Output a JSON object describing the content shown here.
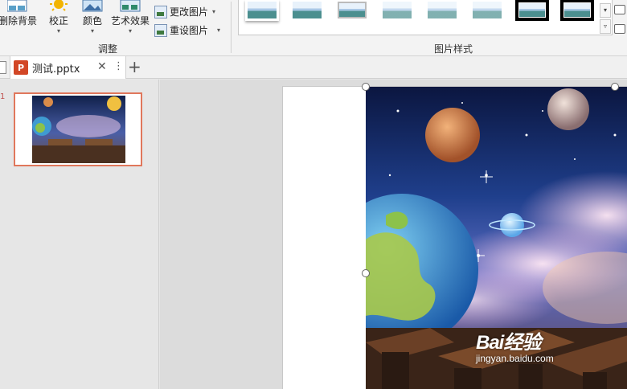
{
  "ribbon": {
    "remove_background": "删除背景",
    "corrections": "校正",
    "color": "颜色",
    "artistic_effects": "艺术效果",
    "change_picture": "更改图片",
    "reset_picture": "重设图片",
    "adjust_group": "调整",
    "picture_styles_group": "图片样式"
  },
  "tabs": {
    "document_name": "测试.pptx",
    "app_icon_letter": "P"
  },
  "thumbnails": {
    "slide_number": "1"
  },
  "watermark": {
    "brand": "Bai经验",
    "url": "jingyan.baidu.com"
  },
  "colors": {
    "accent": "#d24726",
    "selection": "#e0775c"
  }
}
